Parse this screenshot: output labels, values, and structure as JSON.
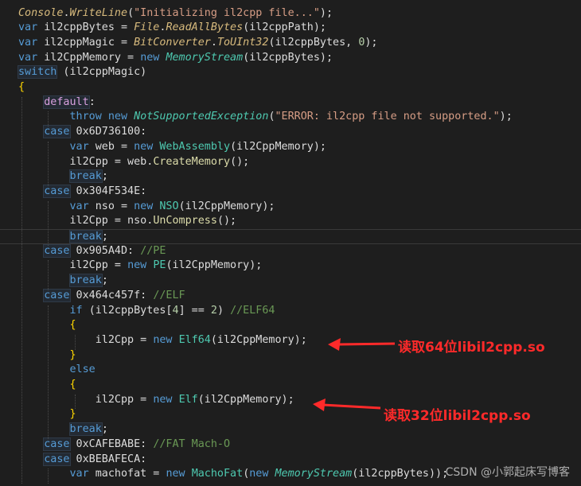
{
  "editor": {
    "lines": [
      [
        [
          "ital",
          "Console"
        ],
        [
          "plain",
          "."
        ],
        [
          "ital",
          "WriteLine"
        ],
        [
          "plain",
          "("
        ],
        [
          "str",
          "\"Initializing il2cpp file...\""
        ],
        [
          "plain",
          ");"
        ]
      ],
      [
        [
          "kw",
          "var "
        ],
        [
          "plain",
          "il2cppBytes = "
        ],
        [
          "ital",
          "File"
        ],
        [
          "plain",
          "."
        ],
        [
          "ital",
          "ReadAllBytes"
        ],
        [
          "plain",
          "(il2cppPath);"
        ]
      ],
      [
        [
          "kw",
          "var "
        ],
        [
          "plain",
          "il2cppMagic = "
        ],
        [
          "ital",
          "BitConverter"
        ],
        [
          "plain",
          "."
        ],
        [
          "ital",
          "ToUInt32"
        ],
        [
          "plain",
          "(il2cppBytes, "
        ],
        [
          "num",
          "0"
        ],
        [
          "plain",
          ");"
        ]
      ],
      [
        [
          "kw",
          "var "
        ],
        [
          "plain",
          "il2CppMemory = "
        ],
        [
          "kw",
          "new "
        ],
        [
          "ital-g",
          "MemoryStream"
        ],
        [
          "plain",
          "(il2cppBytes);"
        ]
      ],
      [
        [
          "kwbox",
          "switch"
        ],
        [
          "plain",
          " (il2cppMagic)"
        ]
      ],
      [
        [
          "brace",
          "{"
        ]
      ],
      [
        [
          "plain",
          "    "
        ],
        [
          "kwhl",
          "default"
        ],
        [
          "plain",
          ":"
        ]
      ],
      [
        [
          "plain",
          "        "
        ],
        [
          "kw",
          "throw "
        ],
        [
          "kw",
          "new "
        ],
        [
          "ital-g",
          "NotSupportedException"
        ],
        [
          "plain",
          "("
        ],
        [
          "str",
          "\"ERROR: il2cpp file not supported.\""
        ],
        [
          "plain",
          ");"
        ]
      ],
      [
        [
          "plain",
          "    "
        ],
        [
          "kwbox",
          "case"
        ],
        [
          "plain",
          " 0x6D736100:"
        ]
      ],
      [
        [
          "plain",
          "        "
        ],
        [
          "kw",
          "var "
        ],
        [
          "plain",
          "web = "
        ],
        [
          "kw",
          "new "
        ],
        [
          "type",
          "WebAssembly"
        ],
        [
          "plain",
          "(il2CppMemory);"
        ]
      ],
      [
        [
          "plain",
          "        "
        ],
        [
          "plain",
          "il2Cpp = web."
        ],
        [
          "meth",
          "CreateMemory"
        ],
        [
          "plain",
          "();"
        ]
      ],
      [
        [
          "plain",
          "        "
        ],
        [
          "kwbox",
          "break"
        ],
        [
          "plain",
          ";"
        ]
      ],
      [
        [
          "plain",
          "    "
        ],
        [
          "kwbox",
          "case"
        ],
        [
          "plain",
          " 0x304F534E:"
        ]
      ],
      [
        [
          "plain",
          "        "
        ],
        [
          "kw",
          "var "
        ],
        [
          "plain",
          "nso = "
        ],
        [
          "kw",
          "new "
        ],
        [
          "type",
          "NSO"
        ],
        [
          "plain",
          "(il2CppMemory);"
        ]
      ],
      [
        [
          "plain",
          "        "
        ],
        [
          "plain",
          "il2Cpp = nso."
        ],
        [
          "meth",
          "UnCompress"
        ],
        [
          "plain",
          "();"
        ]
      ],
      [
        [
          "plain",
          "        "
        ],
        [
          "kwbox",
          "break"
        ],
        [
          "plain",
          ";"
        ]
      ],
      [
        [
          "plain",
          "    "
        ],
        [
          "kwbox",
          "case"
        ],
        [
          "plain",
          " 0x905A4D: "
        ],
        [
          "comment",
          "//PE"
        ]
      ],
      [
        [
          "plain",
          "        "
        ],
        [
          "plain",
          "il2Cpp = "
        ],
        [
          "kw",
          "new "
        ],
        [
          "type",
          "PE"
        ],
        [
          "plain",
          "(il2CppMemory);"
        ]
      ],
      [
        [
          "plain",
          "        "
        ],
        [
          "kwbox",
          "break"
        ],
        [
          "plain",
          ";"
        ]
      ],
      [
        [
          "plain",
          "    "
        ],
        [
          "kwbox",
          "case"
        ],
        [
          "plain",
          " 0x464c457f: "
        ],
        [
          "comment",
          "//ELF"
        ]
      ],
      [
        [
          "plain",
          "        "
        ],
        [
          "kw",
          "if "
        ],
        [
          "plain",
          "(il2cppBytes["
        ],
        [
          "num",
          "4"
        ],
        [
          "plain",
          "] == "
        ],
        [
          "num",
          "2"
        ],
        [
          "plain",
          ") "
        ],
        [
          "comment",
          "//ELF64"
        ]
      ],
      [
        [
          "plain",
          "        "
        ],
        [
          "brace",
          "{"
        ]
      ],
      [
        [
          "plain",
          "            "
        ],
        [
          "plain",
          "il2Cpp = "
        ],
        [
          "kw",
          "new "
        ],
        [
          "type",
          "Elf64"
        ],
        [
          "plain",
          "(il2CppMemory);"
        ]
      ],
      [
        [
          "plain",
          "        "
        ],
        [
          "brace",
          "}"
        ]
      ],
      [
        [
          "plain",
          "        "
        ],
        [
          "kw",
          "else"
        ]
      ],
      [
        [
          "plain",
          "        "
        ],
        [
          "brace",
          "{"
        ]
      ],
      [
        [
          "plain",
          "            "
        ],
        [
          "plain",
          "il2Cpp = "
        ],
        [
          "kw",
          "new "
        ],
        [
          "type",
          "Elf"
        ],
        [
          "plain",
          "(il2CppMemory);"
        ]
      ],
      [
        [
          "plain",
          "        "
        ],
        [
          "brace",
          "}"
        ]
      ],
      [
        [
          "plain",
          "        "
        ],
        [
          "kwbox",
          "break"
        ],
        [
          "plain",
          ";"
        ]
      ],
      [
        [
          "plain",
          "    "
        ],
        [
          "kwbox",
          "case"
        ],
        [
          "plain",
          " 0xCAFEBABE: "
        ],
        [
          "comment",
          "//FAT Mach-O"
        ]
      ],
      [
        [
          "plain",
          "    "
        ],
        [
          "kwbox",
          "case"
        ],
        [
          "plain",
          " 0xBEBAFECA:"
        ]
      ],
      [
        [
          "plain",
          "        "
        ],
        [
          "kw",
          "var "
        ],
        [
          "plain",
          "machofat = "
        ],
        [
          "kw",
          "new "
        ],
        [
          "type",
          "MachoFat"
        ],
        [
          "plain",
          "("
        ],
        [
          "kw",
          "new "
        ],
        [
          "ital-g",
          "MemoryStream"
        ],
        [
          "plain",
          "(il2cppBytes));"
        ]
      ]
    ]
  },
  "annotations": {
    "elf64_note": "读取64位libil2cpp.so",
    "elf32_note": "读取32位libil2cpp.so",
    "color": "#ff2a2a"
  },
  "watermark": "CSDN @小郭起床写博客"
}
